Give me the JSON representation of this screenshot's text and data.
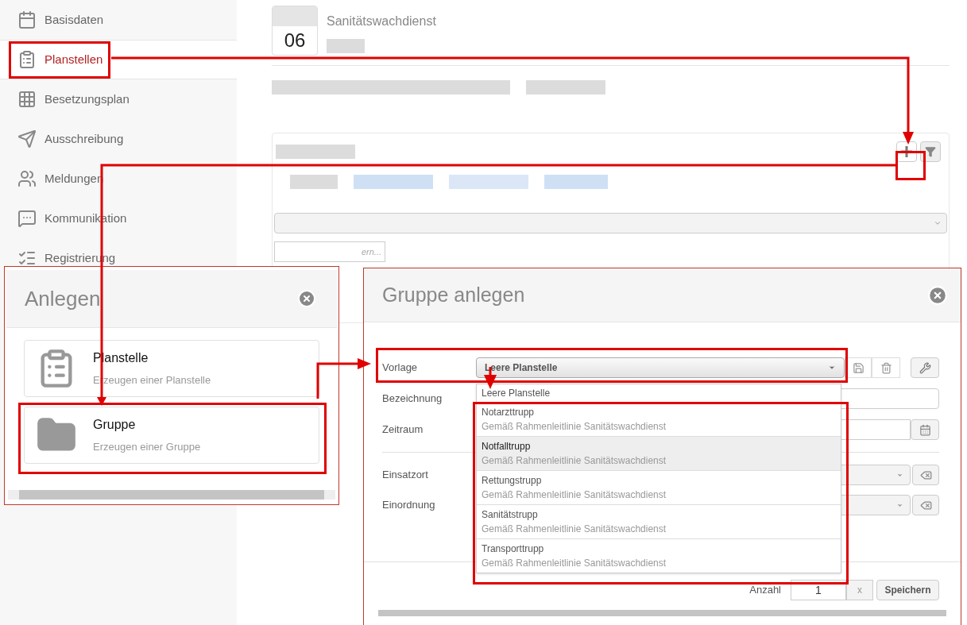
{
  "sidebar": {
    "items": [
      {
        "label": "Basisdaten",
        "selected": false
      },
      {
        "label": "Planstellen",
        "selected": true
      },
      {
        "label": "Besetzungsplan",
        "selected": false
      },
      {
        "label": "Ausschreibung",
        "selected": false
      },
      {
        "label": "Meldungen",
        "selected": false
      },
      {
        "label": "Kommunikation",
        "selected": false
      },
      {
        "label": "Registrierung",
        "selected": false
      }
    ]
  },
  "header": {
    "day": "06",
    "title": "Sanitätswachdienst"
  },
  "filter_hint": "ern...",
  "create_dialog": {
    "title": "Anlegen",
    "options": [
      {
        "title": "Planstelle",
        "subtitle": "Erzeugen einer Planstelle"
      },
      {
        "title": "Gruppe",
        "subtitle": "Erzeugen einer Gruppe"
      }
    ]
  },
  "group_dialog": {
    "title": "Gruppe anlegen",
    "fields": [
      {
        "label": "Vorlage",
        "kind": "template",
        "value": "Leere Planstelle"
      },
      {
        "label": "Bezeichnung",
        "kind": "text"
      },
      {
        "label": "Zeitraum",
        "kind": "date"
      }
    ],
    "location_fields": [
      {
        "label": "Einsatzort",
        "kind": "clearable"
      },
      {
        "label": "Einordnung",
        "kind": "clearable"
      }
    ],
    "dropdown": [
      {
        "title": "Leere Planstelle",
        "selected": false
      },
      {
        "title": "Notarzttrupp",
        "subtitle": "Gemäß Rahmenleitlinie Sanitätswachdienst",
        "selected": false
      },
      {
        "title": "Notfalltrupp",
        "subtitle": "Gemäß Rahmenleitlinie Sanitätswachdienst",
        "selected": true
      },
      {
        "title": "Rettungstrupp",
        "subtitle": "Gemäß Rahmenleitlinie Sanitätswachdienst",
        "selected": false
      },
      {
        "title": "Sanitätstrupp",
        "subtitle": "Gemäß Rahmenleitlinie Sanitätswachdienst",
        "selected": false
      },
      {
        "title": "Transporttrupp",
        "subtitle": "Gemäß Rahmenleitlinie Sanitätswachdienst",
        "selected": false
      }
    ],
    "footer": {
      "count_label": "Anzahl",
      "count_value": "1",
      "clear": "x",
      "save": "Speichern"
    }
  }
}
